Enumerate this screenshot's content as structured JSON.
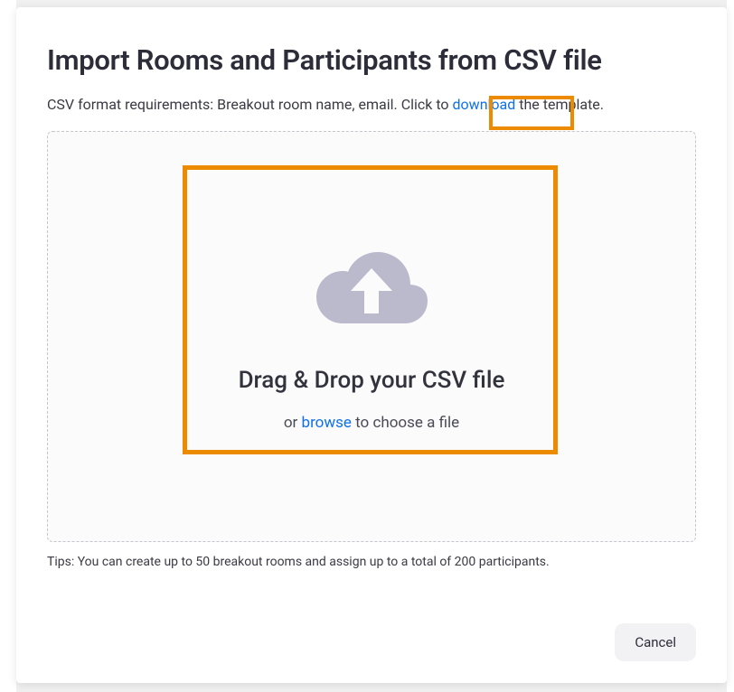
{
  "modal": {
    "title": "Import Rooms and Participants from CSV file",
    "subtitle_prefix": "CSV format requirements: Breakout room name, email. Click to ",
    "download_link": "download",
    "subtitle_suffix": " the template.",
    "dropzone": {
      "title": "Drag & Drop your CSV file",
      "or_text": "or ",
      "browse_link": "browse",
      "suffix_text": " to choose a file"
    },
    "tips": "Tips: You can create up to 50 breakout rooms and assign up to a total of 200 participants.",
    "cancel_label": "Cancel"
  }
}
